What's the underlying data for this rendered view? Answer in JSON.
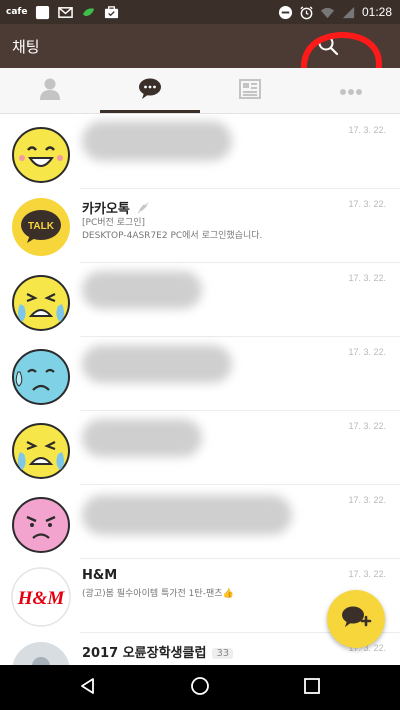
{
  "status_bar": {
    "carrier": "cafe",
    "time": "01:28",
    "icons": [
      "white-square-icon",
      "mail-icon",
      "leaf-icon",
      "briefcase-icon",
      "do-not-disturb-icon",
      "alarm-icon",
      "wifi-icon",
      "signal-icon"
    ]
  },
  "app_bar": {
    "title": "채팅",
    "search_icon": "search-icon"
  },
  "tabs": [
    {
      "name": "friends",
      "icon": "person-icon"
    },
    {
      "name": "chats",
      "icon": "speech-bubble-icon",
      "active": true
    },
    {
      "name": "channel",
      "icon": "news-grid-icon"
    },
    {
      "name": "more",
      "icon": "more-icon"
    }
  ],
  "chats": [
    {
      "avatar": "smiling-face-avatar",
      "name": "",
      "message": "",
      "date": "17. 3. 22."
    },
    {
      "avatar": "kakaotalk-avatar",
      "name": "카카오톡",
      "muted_icon": "mute-icon",
      "message_line1": "[PC버전 로그인]",
      "message_line2": "DESKTOP-4ASR7E2 PC에서 로그인했습니다.",
      "date": "17. 3. 22.",
      "avatar_text": "TALK"
    },
    {
      "avatar": "crying-face-avatar",
      "name": "",
      "message": "",
      "date": "17. 3. 22."
    },
    {
      "avatar": "sweating-face-avatar",
      "name": "",
      "message": "",
      "date": "17. 3. 22."
    },
    {
      "avatar": "crying-face-avatar",
      "name": "",
      "message": "",
      "date": "17. 3. 22."
    },
    {
      "avatar": "angry-face-avatar",
      "name": "",
      "message": "",
      "date": "17. 3. 22."
    },
    {
      "avatar": "hm-logo-avatar",
      "name": "H&M",
      "message": "(광고)봄 필수아이템 특가전 1탄-팬츠👍",
      "date": "17. 3. 22.",
      "avatar_text": "H&M"
    },
    {
      "avatar": "photo-avatar",
      "name": "2017 오륜장학생클럽",
      "badge": "33",
      "message": "",
      "date": "17. 3. 22."
    }
  ],
  "fab": {
    "icon": "new-chat-icon"
  },
  "nav_bar": {
    "icons": [
      "back-icon",
      "home-icon",
      "recents-icon"
    ]
  },
  "colors": {
    "status_bar": "#3b2f2a",
    "app_bar": "#4c3b34",
    "kakao_yellow": "#f6d63a",
    "annotation_red": "#ff1a1a"
  }
}
